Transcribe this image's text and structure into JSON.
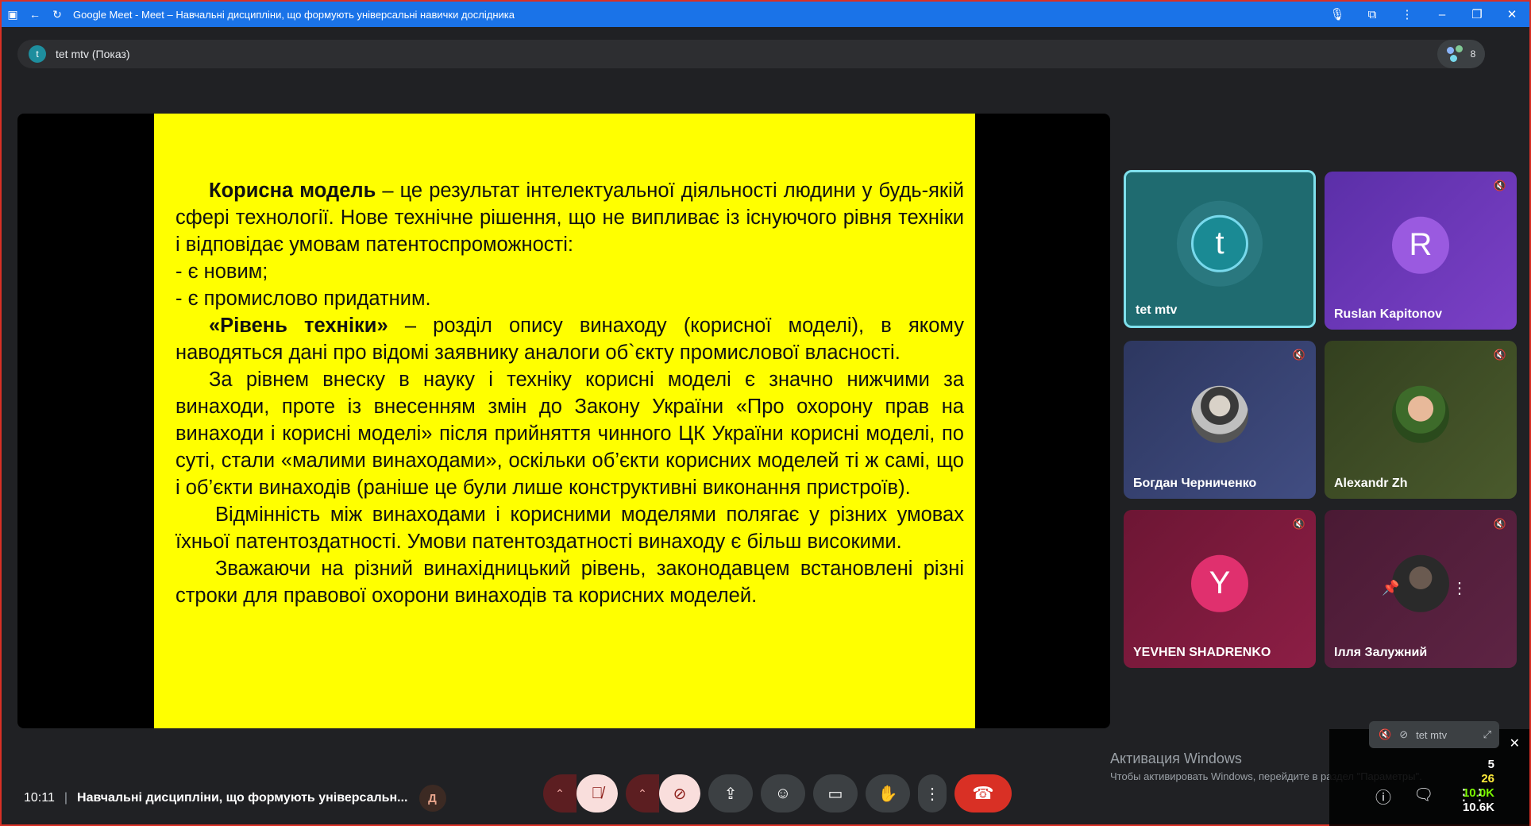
{
  "window": {
    "title": "Google Meet - Meet – Навчальні дисципліни, що формують універсальні навички дослідника"
  },
  "presenter": {
    "avatar_letter": "t",
    "label": "tet mtv (Показ)",
    "participant_count": "8"
  },
  "slide": {
    "p1_bold": "Корисна модель",
    "p1_text": " – це результат інтелектуальної діяльності людини у будь-якій сфері технології. Нове технічне рішення, що не випливає із існуючого рівня техніки і відповідає умовам патентоспроможності:",
    "p2": "- є новим;",
    "p3": "- є промислово придатним.",
    "p4_bold": "«Рівень техніки»",
    "p4_text": " – розділ опису винаходу (корисної моделі), в якому наводяться дані про відомі заявнику аналоги об`єкту промислової власності.",
    "p5": "За рівнем внеску в науку і техніку корисні моделі є значно нижчими за винаходи, проте із внесенням змін до Закону України «Про охорону прав на винаходи і корисні моделі» після прийняття чинного ЦК України корисні моделі, по суті, стали «малими винаходами», оскільки об’єкти корисних моделей ті ж самі, що і об’єкти винаходів (раніше це були лише конструктивні виконання пристроїв).",
    "p6": "Відмінність між винаходами і корисними моделями полягає у різних умовах їхньої патентоздатності. Умови патентоздатності винаходу є більш високими.",
    "p7": "Зважаючи на різний винахідницький рівень, законодавцем встановлені різні строки для правової охорони винаходів та корисних моделей."
  },
  "participants": [
    {
      "name": "tet mtv",
      "avatar": "t",
      "color": "#1a6e74"
    },
    {
      "name": "Ruslan Kapitonov",
      "avatar": "R",
      "color": "#7b40c6"
    },
    {
      "name": "Богдан Черниченко",
      "avatar": "",
      "color": "#3a4672"
    },
    {
      "name": "Alexandr Zh",
      "avatar": "",
      "color": "#4a5a2c"
    },
    {
      "name": "YEVHEN SHADRENKO",
      "avatar": "Y",
      "color": "#c2185b"
    },
    {
      "name": "Ілля Залужний",
      "avatar": "",
      "color": "#5a2040"
    }
  ],
  "footer": {
    "time": "10:11",
    "meeting_title": "Навчальні дисципліни, що формують універсальн...",
    "badge": "Д"
  },
  "self_view": {
    "name": "tet mtv"
  },
  "windows_activation": {
    "line1": "Активация Windows",
    "line2": "Чтобы активировать Windows, перейдите в раздел \"Параметры\"."
  },
  "system_overlay": {
    "v1": "5",
    "v2": "26",
    "v3": "10.0K",
    "v4": "10.6K"
  }
}
